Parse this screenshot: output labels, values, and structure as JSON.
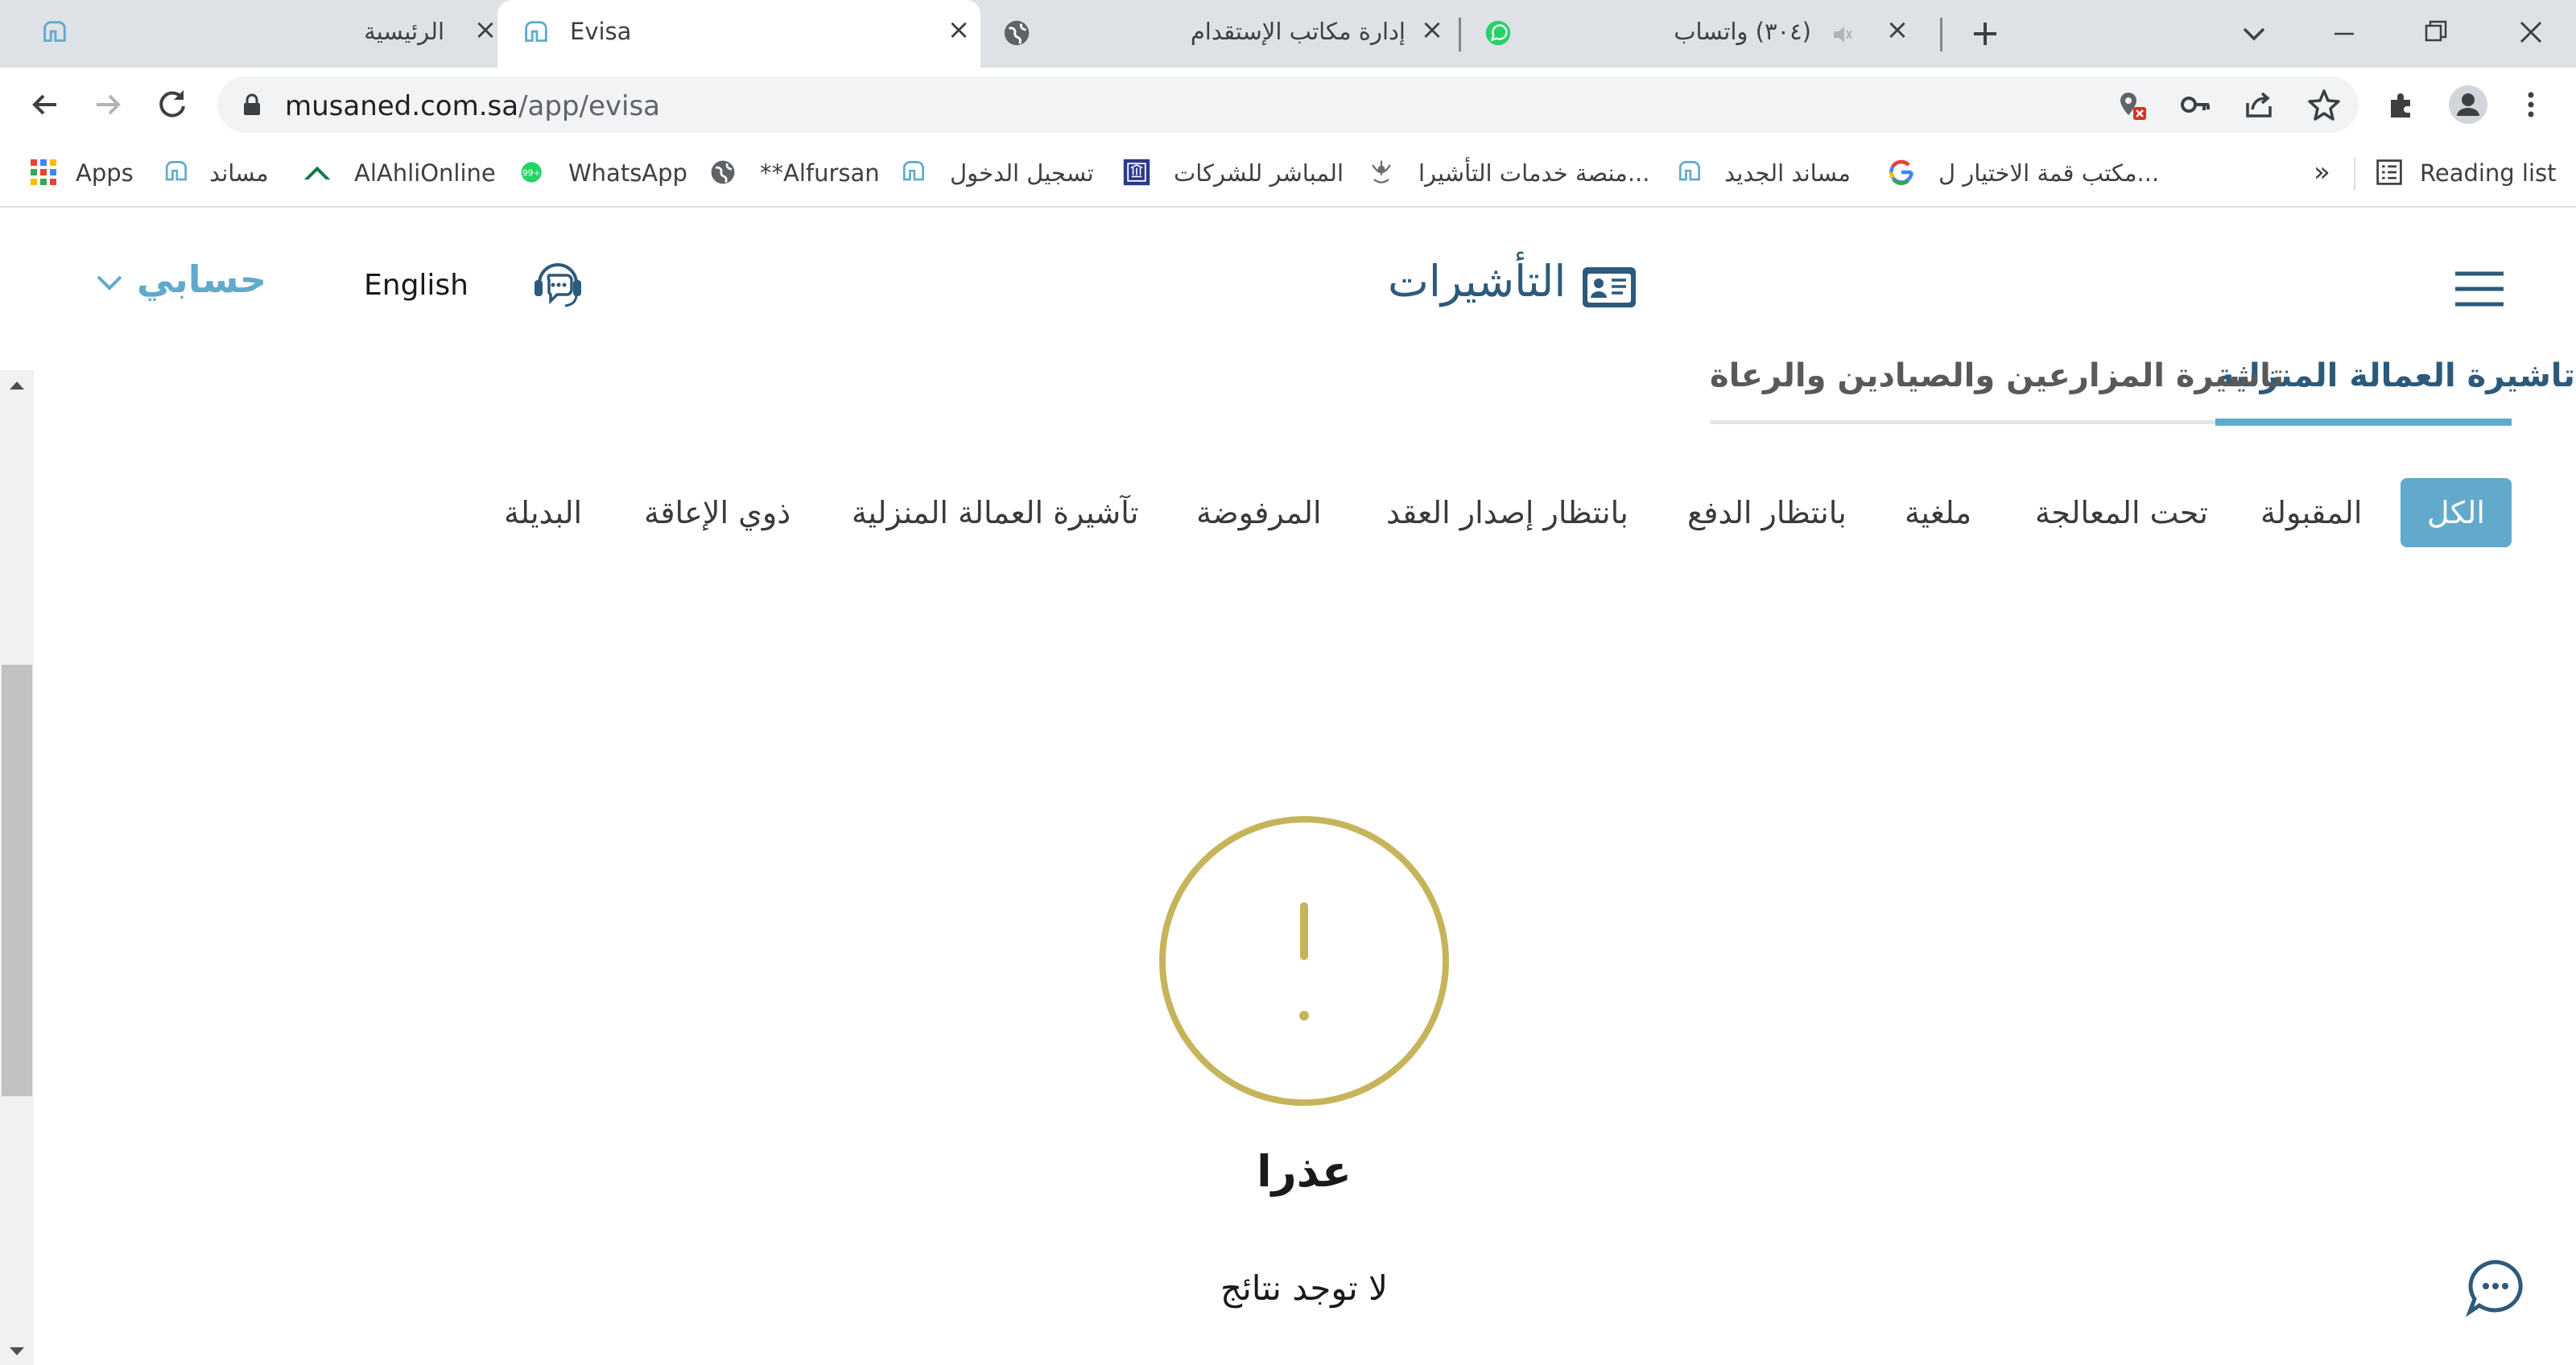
{
  "browser": {
    "tabs": [
      {
        "title": "الرئيسية",
        "active": false
      },
      {
        "title": "Evisa",
        "active": true
      },
      {
        "title": "إدارة مكاتب الإستقدام",
        "active": false
      },
      {
        "title": "(٣٠٤) واتساب",
        "active": false
      }
    ],
    "address": {
      "domain": "musaned.com.sa",
      "path": "/app/evisa"
    },
    "bookmarks": [
      {
        "label": "Apps",
        "icon": "apps-grid-icon"
      },
      {
        "label": "مساند",
        "icon": "musaned-icon"
      },
      {
        "label": "AlAhliOnline",
        "icon": "alahli-icon"
      },
      {
        "label": "WhatsApp",
        "icon": "whatsapp-icon",
        "badge": "99+"
      },
      {
        "label": "**Alfursan",
        "icon": "globe-icon"
      },
      {
        "label": "تسجيل الدخول",
        "icon": "musaned-icon"
      },
      {
        "label": "المباشر للشركات",
        "icon": "bank-icon"
      },
      {
        "label": "منصة خدمات التأشيرا...",
        "icon": "emblem-icon"
      },
      {
        "label": "مساند الجديد",
        "icon": "musaned-icon"
      },
      {
        "label": "مكتب قمة الاختيار ل...",
        "icon": "google-icon"
      }
    ],
    "more_bookmarks": "»",
    "reading_list": "Reading list"
  },
  "header": {
    "title": "التأشيرات",
    "language": "English",
    "account": "حسابي"
  },
  "main_tabs": [
    {
      "label": "تاشيرة العمالة المنزلية",
      "active": true
    },
    {
      "label": "تاشيرة المزارعين والصيادين والرعاة",
      "active": false
    }
  ],
  "filters": [
    {
      "label": "الكل",
      "active": true
    },
    {
      "label": "المقبولة",
      "active": false
    },
    {
      "label": "تحت المعالجة",
      "active": false
    },
    {
      "label": "ملغية",
      "active": false
    },
    {
      "label": "بانتظار الدفع",
      "active": false
    },
    {
      "label": "بانتظار إصدار العقد",
      "active": false
    },
    {
      "label": "المرفوضة",
      "active": false
    },
    {
      "label": "تآشيرة العمالة المنزلية",
      "active": false
    },
    {
      "label": "ذوي الإعاقة",
      "active": false
    },
    {
      "label": "البديلة",
      "active": false
    }
  ],
  "empty_state": {
    "title": "عذرا",
    "message": "لا توجد نتائج"
  },
  "colors": {
    "accent": "#62aacb",
    "heading": "#2d5a7b",
    "warning": "#c6b45a"
  }
}
